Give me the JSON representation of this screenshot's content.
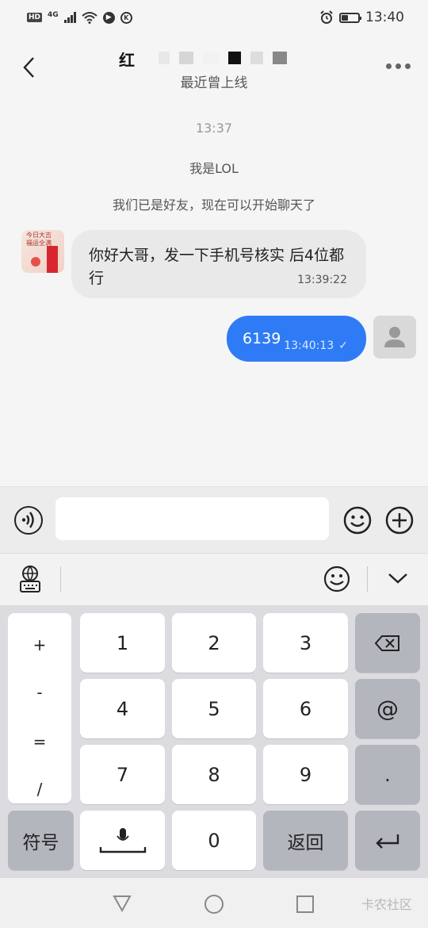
{
  "status_bar": {
    "hd": "HD",
    "network": "4G",
    "time": "13:40",
    "k_icon": "K"
  },
  "header": {
    "title": "红",
    "subtitle": "最近曾上线"
  },
  "chat": {
    "timestamp": "13:37",
    "system_messages": [
      "我是LOL",
      "我们已是好友，现在可以开始聊天了"
    ],
    "incoming": {
      "text": "你好大哥，发一下手机号核实 后4位都行",
      "time": "13:39:22"
    },
    "outgoing": {
      "text": "6139",
      "time": "13:40:13",
      "status": "✓"
    }
  },
  "input": {
    "value": "",
    "placeholder": ""
  },
  "keyboard": {
    "symbols": [
      "+",
      "-",
      "=",
      "/"
    ],
    "digits": [
      "1",
      "2",
      "3",
      "4",
      "5",
      "6",
      "7",
      "8",
      "9",
      "0"
    ],
    "at": "@",
    "dot": ".",
    "symbol_key": "符号",
    "back_key": "返回"
  },
  "watermark": "卡农社区",
  "colors": {
    "accent": "#2f7bf5",
    "incoming_bubble": "#e9e9e9",
    "keyboard_bg": "#dcdce0",
    "dark_key": "#b3b6bd"
  },
  "icons": [
    "back-arrow-icon",
    "more-icon",
    "voice-icon",
    "emoji-icon",
    "plus-icon",
    "keyboard-language-icon",
    "collapse-icon",
    "backspace-icon",
    "microphone-icon",
    "enter-icon",
    "nav-back-icon",
    "nav-home-icon",
    "nav-recent-icon"
  ]
}
